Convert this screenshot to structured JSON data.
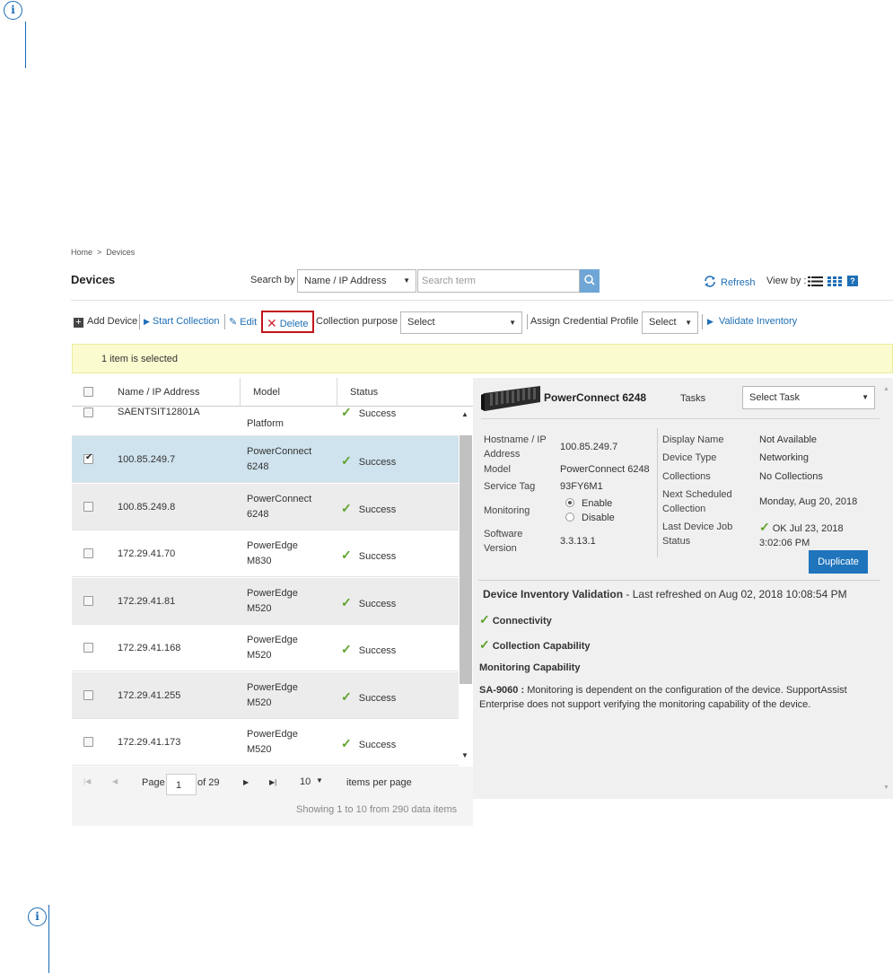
{
  "breadcrumb": {
    "home": "Home",
    "separator": ">",
    "current": "Devices"
  },
  "page_title": "Devices",
  "search": {
    "label": "Search by",
    "field": "Name / IP Address",
    "placeholder": "Search term"
  },
  "header_actions": {
    "refresh": "Refresh",
    "view_by": "View by :"
  },
  "toolbar": {
    "add_device": "Add Device",
    "start_collection": "Start Collection",
    "edit": "Edit",
    "delete": "Delete",
    "collection_purpose_label": "Collection purpose",
    "collection_purpose_value": "Select",
    "assign_credential_label": "Assign Credential Profile",
    "assign_credential_value": "Select",
    "validate_inventory": "Validate Inventory"
  },
  "banner": "1 item is selected",
  "grid": {
    "columns": [
      "Name / IP Address",
      "Model",
      "Status"
    ],
    "partial_row": {
      "name": "SAENTSIT12801A",
      "model_line2": "Platform",
      "status": "Success"
    },
    "rows": [
      {
        "name": "100.85.249.7",
        "model1": "PowerConnect",
        "model2": "6248",
        "status": "Success",
        "checked": true
      },
      {
        "name": "100.85.249.8",
        "model1": "PowerConnect",
        "model2": "6248",
        "status": "Success",
        "checked": false
      },
      {
        "name": "172.29.41.70",
        "model1": "PowerEdge",
        "model2": "M830",
        "status": "Success",
        "checked": false
      },
      {
        "name": "172.29.41.81",
        "model1": "PowerEdge",
        "model2": "M520",
        "status": "Success",
        "checked": false
      },
      {
        "name": "172.29.41.168",
        "model1": "PowerEdge",
        "model2": "M520",
        "status": "Success",
        "checked": false
      },
      {
        "name": "172.29.41.255",
        "model1": "PowerEdge",
        "model2": "M520",
        "status": "Success",
        "checked": false
      },
      {
        "name": "172.29.41.173",
        "model1": "PowerEdge",
        "model2": "M520",
        "status": "Success",
        "checked": false
      }
    ]
  },
  "pager": {
    "page_label": "Page",
    "page": "1",
    "of": "of 29",
    "per_page": "10",
    "per_page_label": "items per page",
    "summary": "Showing 1 to 10 from 290 data items"
  },
  "details": {
    "device_name": "PowerConnect 6248",
    "tasks_label": "Tasks",
    "tasks_value": "Select Task",
    "hostname_label1": "Hostname / IP",
    "hostname_label2": "Address",
    "hostname_value": "100.85.249.7",
    "model_label": "Model",
    "model_value": "PowerConnect 6248",
    "service_tag_label": "Service Tag",
    "service_tag_value": "93FY6M1",
    "monitoring_label": "Monitoring",
    "monitoring_enable": "Enable",
    "monitoring_disable": "Disable",
    "software_label1": "Software",
    "software_label2": "Version",
    "software_value": "3.3.13.1",
    "display_name_label": "Display Name",
    "display_name_value": "Not Available",
    "device_type_label": "Device Type",
    "device_type_value": "Networking",
    "collections_label": "Collections",
    "collections_value": "No Collections",
    "next_sched_label1": "Next Scheduled",
    "next_sched_label2": "Collection",
    "next_sched_value": "Monday, Aug 20, 2018",
    "last_job_label1": "Last Device Job",
    "last_job_label2": "Status",
    "last_job_value1": "OK Jul 23, 2018",
    "last_job_value2": "3:02:06 PM",
    "duplicate": "Duplicate"
  },
  "inventory": {
    "title": "Device Inventory Validation",
    "refreshed": "- Last refreshed on Aug 02, 2018 10:08:54 PM",
    "connectivity": "Connectivity",
    "collection_capability": "Collection Capability",
    "monitoring_capability": "Monitoring Capability",
    "code": "SA-9060 :",
    "message_line1": "Monitoring is dependent on the configuration of the device. SupportAssist",
    "message_line2": "Enterprise does not support verifying the monitoring capability of the device."
  }
}
